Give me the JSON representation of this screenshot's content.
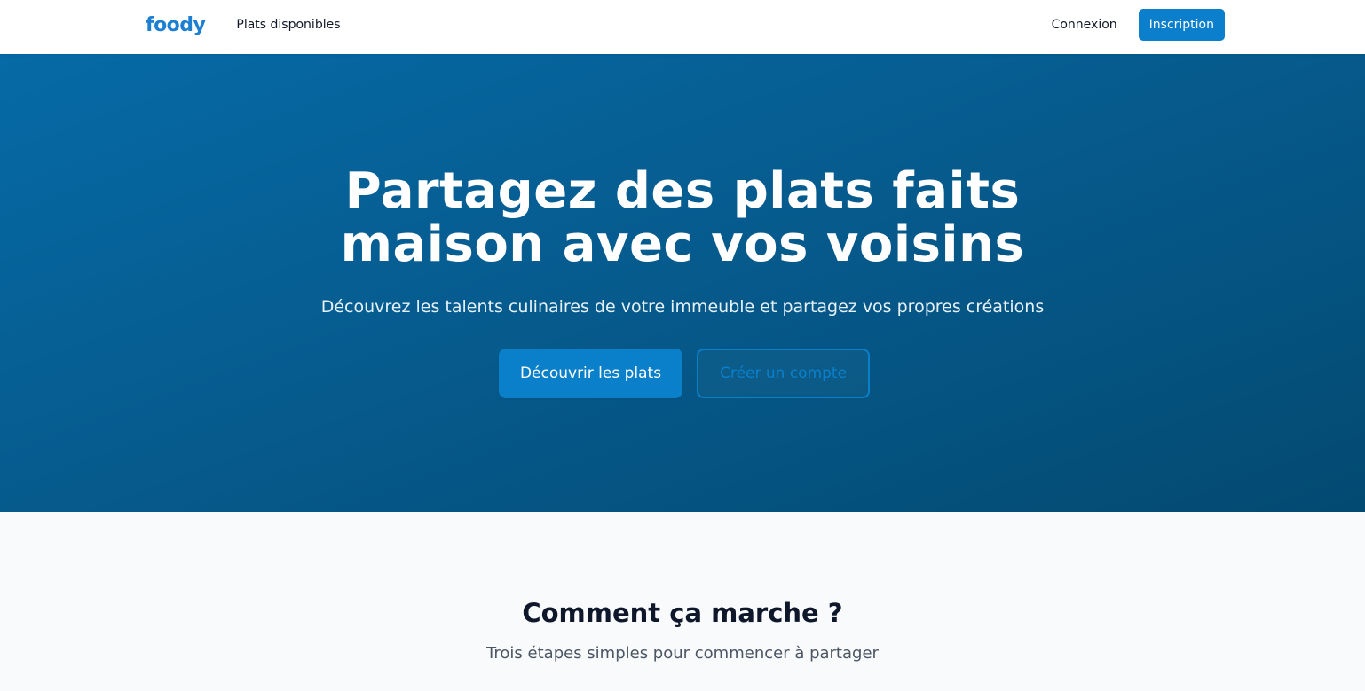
{
  "nav": {
    "logo": "foody",
    "links": [
      {
        "label": "Plats disponibles"
      }
    ],
    "login_label": "Connexion",
    "signup_label": "Inscription"
  },
  "hero": {
    "title_line1": "Partagez des plats faits",
    "title_line2": "maison avec vos voisins",
    "subtitle": "Découvrez les talents culinaires de votre immeuble et partagez vos propres créations",
    "primary_cta": "Découvrir les plats",
    "secondary_cta": "Créer un compte"
  },
  "how_it_works": {
    "title": "Comment ça marche ?",
    "subtitle": "Trois étapes simples pour commencer à partager"
  },
  "colors": {
    "brand": "#1d7fd1",
    "primary_button": "#0a7fca",
    "hero_gradient_start": "#066aa6",
    "hero_gradient_end": "#034a72",
    "section_background": "#f8fafc"
  }
}
